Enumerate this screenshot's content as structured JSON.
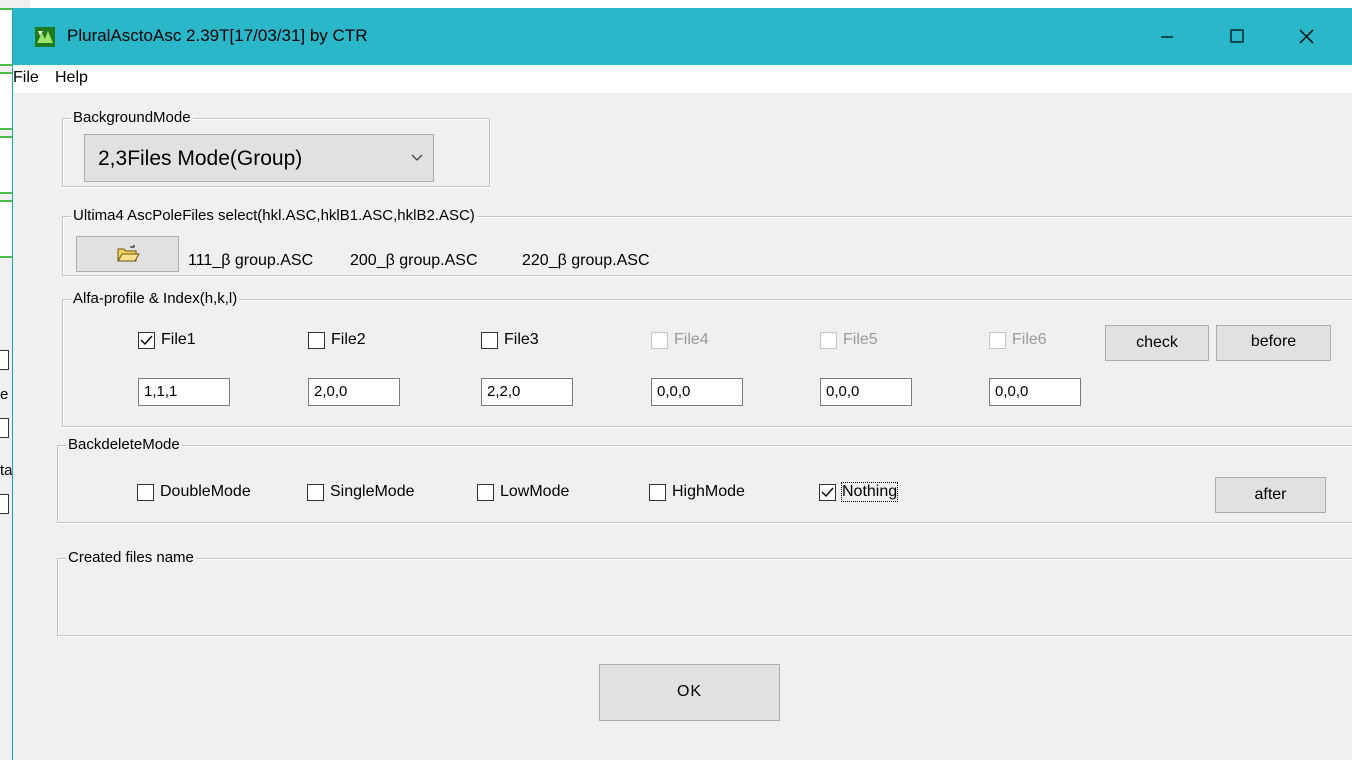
{
  "window": {
    "title": "PluralAsctoAsc 2.39T[17/03/31] by CTR",
    "titlebar_color": "#2ab7ca"
  },
  "background_window": {
    "fragments": [
      "e",
      "ta"
    ]
  },
  "menu": {
    "items": [
      "File",
      "Help"
    ]
  },
  "background_mode": {
    "legend": "BackgroundMode",
    "selected": "2,3Files Mode(Group)"
  },
  "ultima": {
    "legend": "Ultima4 AscPoleFiles select(hkl.ASC,hklB1.ASC,hklB2.ASC)",
    "folder_icon": "open-folder-icon",
    "files": [
      "111_β group.ASC",
      "200_β group.ASC",
      "220_β group.ASC"
    ]
  },
  "alfa": {
    "legend": "Alfa-profile & Index(h,k,l)",
    "files": [
      {
        "label": "File1",
        "checked": true,
        "enabled": true,
        "index": "1,1,1"
      },
      {
        "label": "File2",
        "checked": false,
        "enabled": true,
        "index": "2,0,0"
      },
      {
        "label": "File3",
        "checked": false,
        "enabled": true,
        "index": "2,2,0"
      },
      {
        "label": "File4",
        "checked": false,
        "enabled": false,
        "index": "0,0,0"
      },
      {
        "label": "File5",
        "checked": false,
        "enabled": false,
        "index": "0,0,0"
      },
      {
        "label": "File6",
        "checked": false,
        "enabled": false,
        "index": "0,0,0"
      }
    ],
    "check_label": "check",
    "before_label": "before"
  },
  "backdelete": {
    "legend": "BackdeleteMode",
    "modes": [
      {
        "label": "DoubleMode",
        "checked": false
      },
      {
        "label": "SingleMode",
        "checked": false
      },
      {
        "label": "LowMode",
        "checked": false
      },
      {
        "label": "HighMode",
        "checked": false
      },
      {
        "label": "Nothing",
        "checked": true
      }
    ],
    "after_label": "after"
  },
  "created": {
    "legend": "Created files name",
    "value": ""
  },
  "ok_label": "OK"
}
